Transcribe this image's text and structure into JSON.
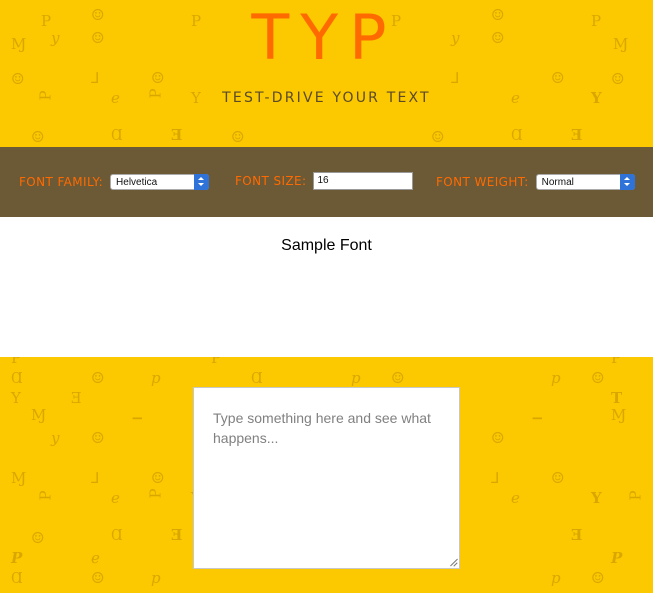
{
  "header": {
    "logo": "TYP",
    "tagline": "TEST-DRIVE YOUR TEXT"
  },
  "controls": {
    "font_family": {
      "label": "FONT FAMILY:",
      "value": "Helvetica"
    },
    "font_size": {
      "label": "FONT SIZE:",
      "value": "16"
    },
    "font_weight": {
      "label": "FONT WEIGHT:",
      "value": "Normal"
    }
  },
  "preview": {
    "sample_text": "Sample Font"
  },
  "editor": {
    "placeholder": "Type something here and see what happens..."
  },
  "colors": {
    "background": "#FCC800",
    "accent": "#FF6A00",
    "controls_bar": "#6C5A36",
    "select_arrow": "#2F73D9"
  },
  "background_glyphs": [
    "P",
    "y",
    "☺",
    "L",
    "e",
    "☺",
    "T",
    "Ɱ",
    "p",
    "Ɐ"
  ]
}
